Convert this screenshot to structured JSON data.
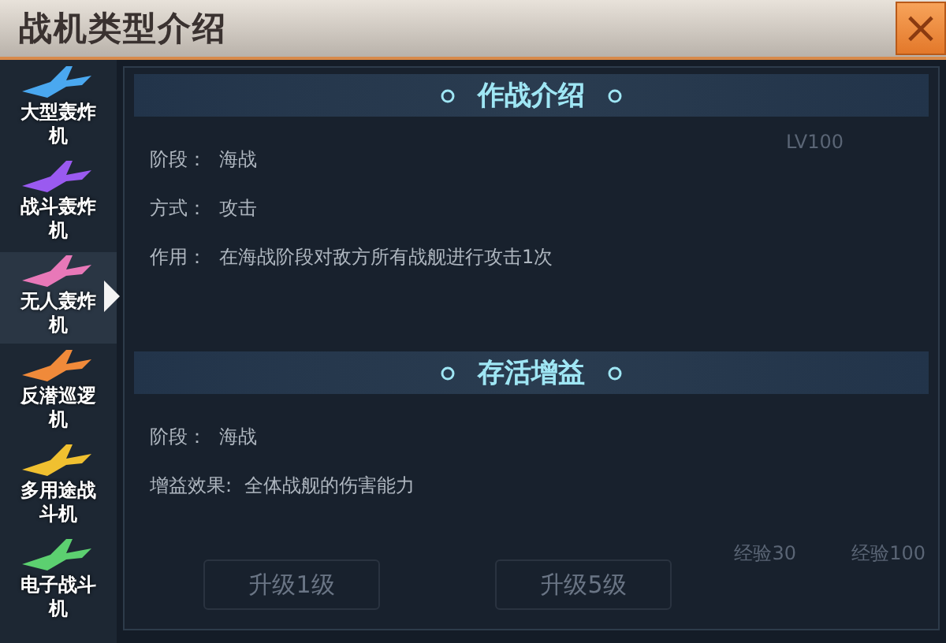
{
  "window": {
    "title": "战机类型介绍",
    "close": "×"
  },
  "sidebar": {
    "items": [
      {
        "label": "大型轰炸机",
        "color": "#4aa8f0",
        "selected": false
      },
      {
        "label": "战斗轰炸机",
        "color": "#9a5af0",
        "selected": false
      },
      {
        "label": "无人轰炸机",
        "color": "#e878b8",
        "selected": true
      },
      {
        "label": "反潜巡逻机",
        "color": "#f08a3a",
        "selected": false
      },
      {
        "label": "多用途战斗机",
        "color": "#f0c030",
        "selected": false
      },
      {
        "label": "电子战斗机",
        "color": "#5cd070",
        "selected": false
      }
    ]
  },
  "sections": [
    {
      "title": "作战介绍",
      "rows": [
        {
          "label": "阶段：",
          "value": "海战"
        },
        {
          "label": "方式：",
          "value": "攻击"
        },
        {
          "label": "作用：",
          "value": "在海战阶段对敌方所有战舰进行攻击1次"
        }
      ]
    },
    {
      "title": "存活增益",
      "rows": [
        {
          "label": "阶段：",
          "value": "海战"
        },
        {
          "label": "增益效果:",
          "value": "全体战舰的伤害能力"
        }
      ]
    }
  ],
  "background": {
    "level": "LV100",
    "buttons": [
      "升级1级",
      "升级5级"
    ],
    "exp": [
      "经验30",
      "经验100"
    ]
  }
}
